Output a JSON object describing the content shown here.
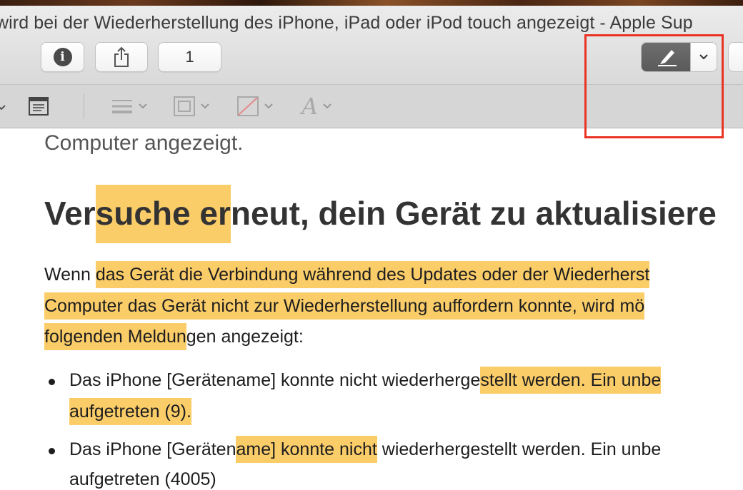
{
  "window": {
    "title": "wird bei der Wiederherstellung des iPhone, iPad oder iPod touch angezeigt - Apple Sup"
  },
  "toolbar": {
    "page_field_value": "1",
    "icons": {
      "info": "info-icon",
      "share": "share-icon",
      "markup": "markup-pen-icon",
      "markup_menu": "chevron-down-icon"
    }
  },
  "markup_toolbar": {
    "icons": [
      "text-box-icon",
      "line-style-icon",
      "border-color-icon",
      "fill-color-icon",
      "text-style-icon"
    ]
  },
  "document": {
    "tail_text": "Computer angezeigt.",
    "heading": {
      "pre": "Ver",
      "hl": "suche er",
      "post": "neut, dein Gerät zu aktualisiere"
    },
    "paragraph": {
      "l1_pre": "Wenn ",
      "l1_hl": "das Gerät die Verbindung während des Updates oder der Wiederherst",
      "l2_hl": "Computer das Gerät nicht zur Wiederherstellung auffordern konnte, wird mö",
      "l3_hl": "folgenden Meldun",
      "l3_post": "gen angezeigt:"
    },
    "bullets": [
      {
        "l1_pre": "Das iPhone [Gerätename] konnte nicht wiederherge",
        "l1_hl": "stellt werden. Ein unbe",
        "l2_hl": "aufgetreten (9)."
      },
      {
        "l1_pre": "Das iPhone [Geräten",
        "l1_hl": "ame] konnte nicht",
        "l1_post": " wiederhergestellt werden. Ein unbe",
        "l2": "aufgetreten (4005)"
      }
    ]
  },
  "colors": {
    "highlight": "#fbcd68",
    "annotation_red": "#ea3323",
    "active_tool": "#5f5f5f"
  }
}
